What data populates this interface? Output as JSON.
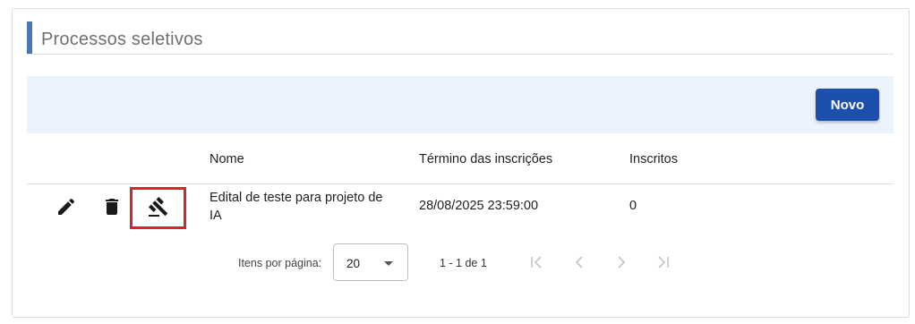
{
  "header": {
    "title": "Processos seletivos"
  },
  "toolbar": {
    "new_label": "Novo"
  },
  "table": {
    "columns": [
      "Nome",
      "Término das inscrições",
      "Inscritos"
    ],
    "rows": [
      {
        "name": "Edital de teste para projeto de IA",
        "deadline": "28/08/2025 23:59:00",
        "enrolled": "0"
      }
    ]
  },
  "paginator": {
    "items_per_page_label": "Itens por página:",
    "items_per_page_value": "20",
    "range_label": "1 - 1 de 1"
  },
  "icons": [
    "edit-icon",
    "delete-icon",
    "gavel-icon",
    "first-page-icon",
    "prev-page-icon",
    "next-page-icon",
    "last-page-icon"
  ],
  "colors": {
    "accent": "#4a76b8",
    "primary_button": "#1d4fae",
    "toolbar_bg": "#ebf3fd",
    "highlight": "#d8232a"
  }
}
